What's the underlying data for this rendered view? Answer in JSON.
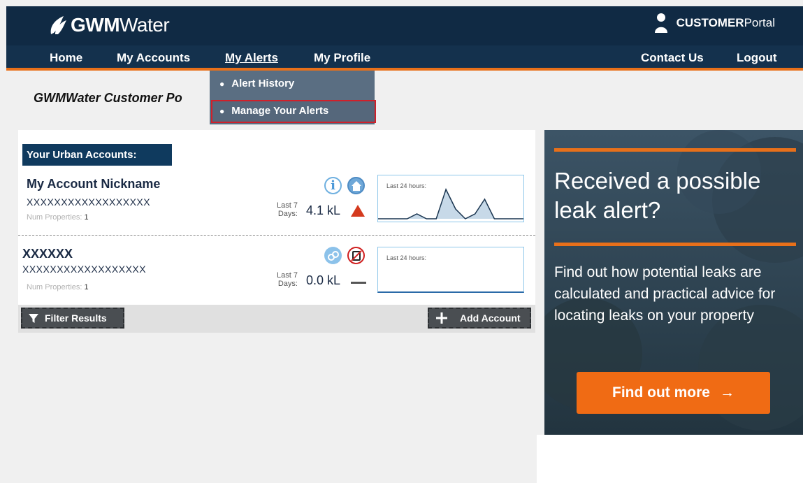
{
  "brand": {
    "logo_bold": "GWM",
    "logo_rest": "Water",
    "portal_bold": "CUSTOMER",
    "portal_rest": "Portal"
  },
  "nav": {
    "home": "Home",
    "my_accounts": "My Accounts",
    "my_alerts": "My Alerts",
    "my_profile": "My Profile",
    "contact_us": "Contact Us",
    "logout": "Logout"
  },
  "alerts_menu": [
    "Alert History",
    "Manage Your Alerts"
  ],
  "page": {
    "title": "GWMWater Customer Po"
  },
  "accounts": {
    "section_title": "Your Urban Accounts:",
    "items": [
      {
        "name": "My Account Nickname",
        "number": "XXXXXXXXXXXXXXXXXX",
        "props_label": "Num Properties:",
        "props_value": "1",
        "last7_line1": "Last 7",
        "last7_line2": "Days:",
        "usage": "4.1 kL",
        "trend": "up",
        "spark_label": "Last 24 hours:",
        "spark": [
          0,
          0,
          0,
          0,
          1,
          0,
          0,
          6,
          2,
          0,
          1,
          4,
          0,
          0,
          0,
          0
        ]
      },
      {
        "name": "XXXXXX",
        "number": "XXXXXXXXXXXXXXXXXX",
        "props_label": "Num Properties:",
        "props_value": "1",
        "last7_line1": "Last 7",
        "last7_line2": "Days:",
        "usage": "0.0 kL",
        "trend": "flat",
        "spark_label": "Last 24 hours:",
        "spark": []
      }
    ],
    "filter_label": "Filter Results",
    "add_label": "Add Account"
  },
  "ad": {
    "title": "Received a possible leak alert?",
    "body": "Find out how potential leaks are calculated and practical advice for locating leaks on your property",
    "button": "Find out more",
    "button_arrow": "→"
  },
  "colors": {
    "navy": "#102a44",
    "orange": "#e8701a",
    "highlight": "#d0202a"
  }
}
